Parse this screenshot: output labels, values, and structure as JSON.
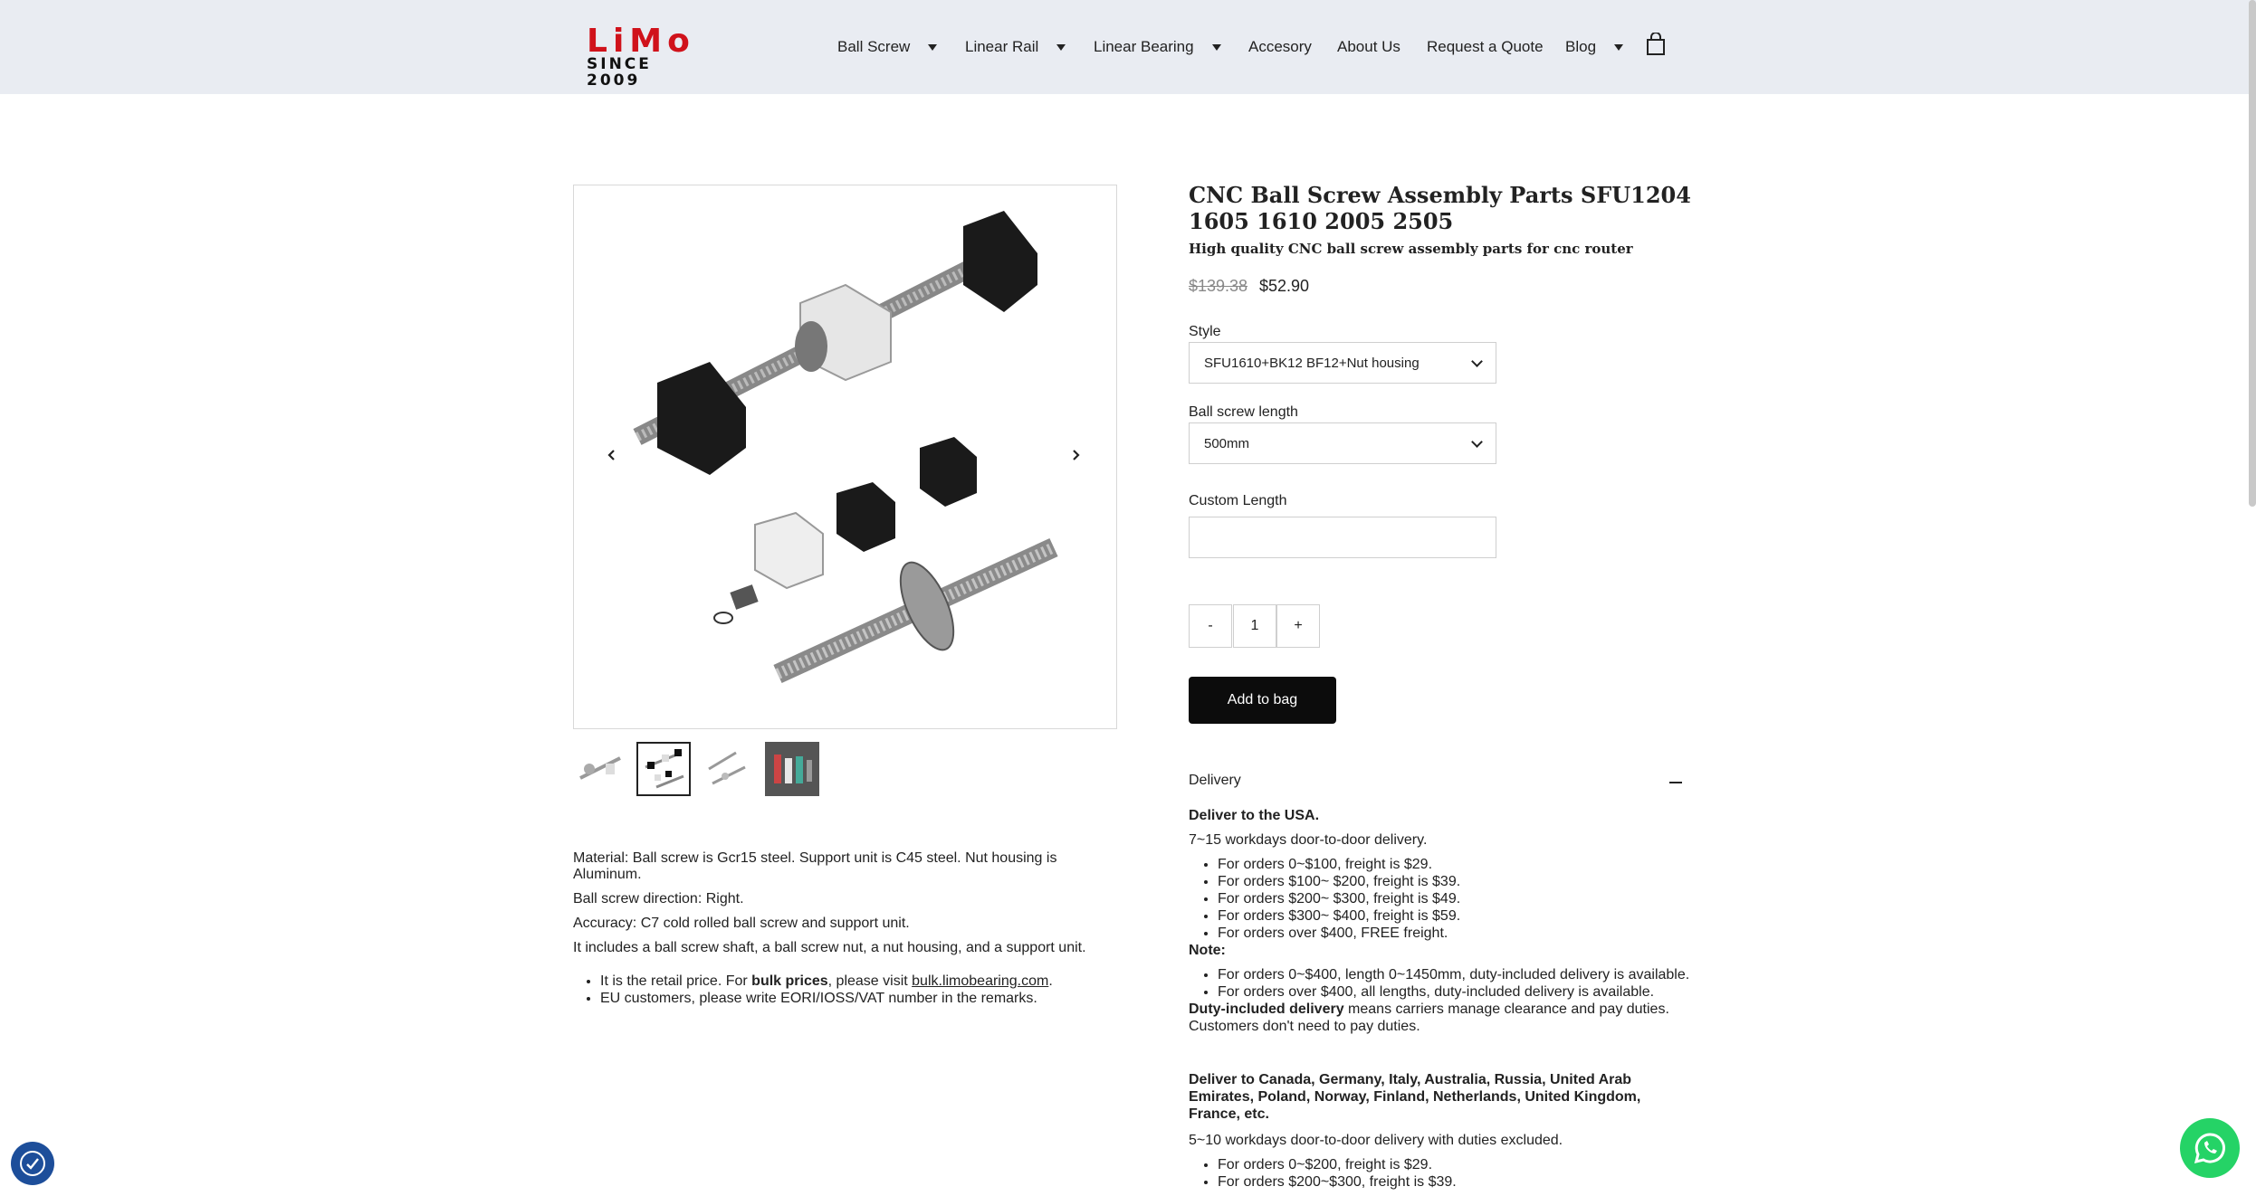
{
  "header": {
    "logo_text": "LiMo",
    "logo_tagline": "SINCE 2009",
    "nav": [
      {
        "label": "Ball Screw",
        "has_dropdown": true
      },
      {
        "label": "Linear Rail",
        "has_dropdown": true
      },
      {
        "label": "Linear Bearing",
        "has_dropdown": true
      },
      {
        "label": "Accesory",
        "has_dropdown": false
      },
      {
        "label": "About Us",
        "has_dropdown": false
      },
      {
        "label": "Request a Quote",
        "has_dropdown": false
      },
      {
        "label": "Blog",
        "has_dropdown": true
      }
    ],
    "cart_icon": "shopping-bag-icon"
  },
  "gallery": {
    "active_thumbnail": 2,
    "thumbnail_count": 4,
    "prev_icon": "chevron-left-icon",
    "next_icon": "chevron-right-icon"
  },
  "product": {
    "title": "CNC Ball Screw Assembly Parts SFU1204 1605 1610 2005 2505",
    "subtitle": "High quality CNC ball screw assembly parts for cnc router",
    "price_original": "$139.38",
    "price_sale": "$52.90",
    "style_label": "Style",
    "style_value": "SFU1610+BK12 BF12+Nut housing",
    "length_label": "Ball screw length",
    "length_value": "500mm",
    "custom_length_label": "Custom Length",
    "custom_length_value": "",
    "qty_minus": "-",
    "qty_value": "1",
    "qty_plus": "+",
    "add_to_bag": "Add to bag"
  },
  "description": {
    "paragraphs": [
      "Material: Ball screw is Gcr15 steel. Support unit is C45 steel. Nut housing is Aluminum.",
      "Ball screw direction: Right.",
      "Accuracy: C7 cold rolled ball screw and support unit.",
      "It includes a ball screw shaft, a ball screw nut, a nut housing, and a support unit."
    ],
    "bullet1_prefix": "It is the retail price. For ",
    "bullet1_bold": "bulk prices",
    "bullet1_mid": ", please visit ",
    "bullet1_link": "bulk.limobearing.com",
    "bullet1_suffix": ".",
    "bullet2": "EU customers, please write EORI/IOSS/VAT number in the remarks."
  },
  "delivery": {
    "heading": "Delivery",
    "usa_title": "Deliver to the USA.",
    "usa_time": "7~15 workdays door-to-door delivery.",
    "usa_rates": [
      "For orders 0~$100, freight is $29.",
      "For orders $100~ $200, freight is $39.",
      "For orders $200~ $300, freight is $49.",
      "For orders $300~ $400, freight is $59.",
      "For orders over $400, FREE freight."
    ],
    "note_label": "Note:",
    "notes": [
      "For orders 0~$400, length 0~1450mm, duty-included delivery is available.",
      "For orders over $400, all lengths, duty-included delivery is available."
    ],
    "duty_bold": "Duty-included delivery",
    "duty_text": " means carriers manage clearance and pay duties. Customers don't need to pay duties.",
    "intl_title": "Deliver to Canada, Germany, Italy, Australia, Russia, United Arab Emirates, Poland, Norway, Finland, Netherlands, United Kingdom, France, etc.",
    "intl_time": "5~10 workdays door-to-door delivery with duties excluded.",
    "intl_rates": [
      "For orders 0~$200, freight is $29.",
      "For orders $200~$300, freight is $39."
    ]
  },
  "widgets": {
    "accessibility_icon": "accessibility-icon",
    "whatsapp_icon": "whatsapp-icon"
  }
}
